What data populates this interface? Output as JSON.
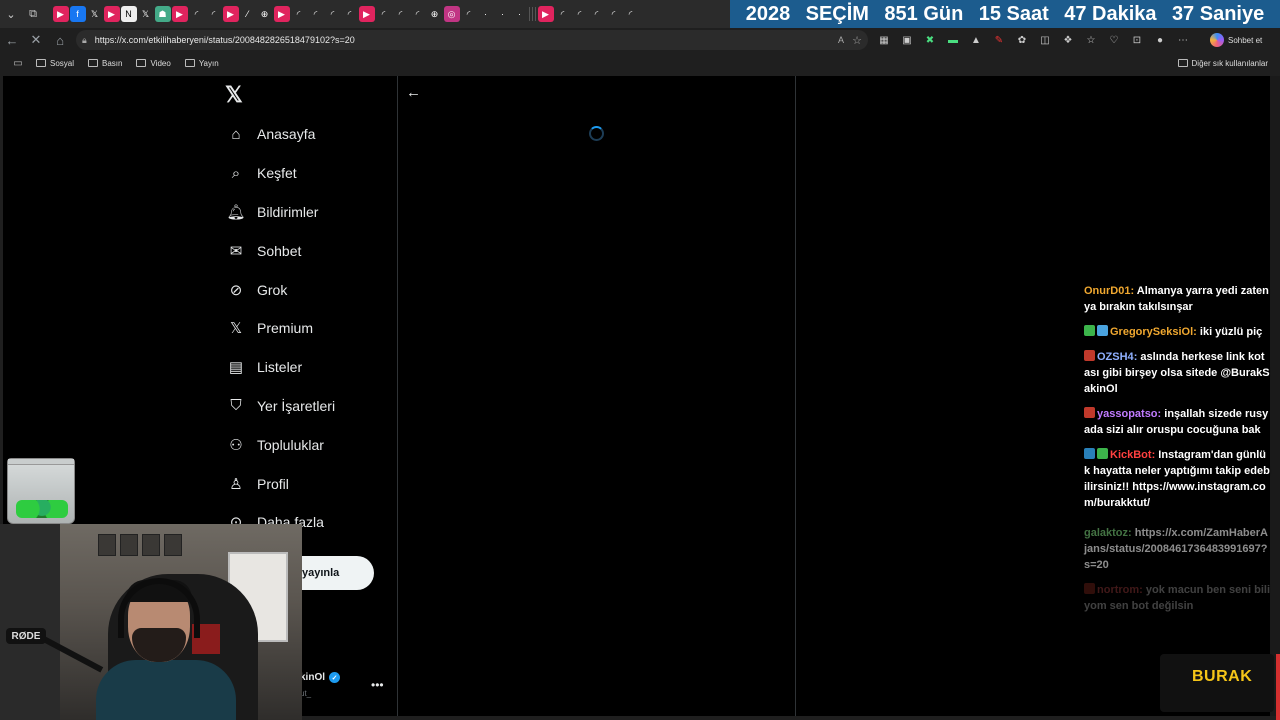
{
  "countdown": {
    "year": "2028",
    "event": "SEÇİM",
    "days": "851 Gün",
    "hours": "15 Saat",
    "minutes": "47 Dakika",
    "seconds": "37 Saniye"
  },
  "address_bar": {
    "url": "https://x.com/etkilihaberyeni/status/2008482826518479102?s=20",
    "copilot_label": "Sohbet et"
  },
  "bookmarks": {
    "items": [
      "Sosyal",
      "Basın",
      "Video",
      "Yayın"
    ],
    "other": "Diğer sık kullanılanlar"
  },
  "x_nav": {
    "items": [
      "Anasayfa",
      "Keşfet",
      "Bildirimler",
      "Sohbet",
      "Grok",
      "Premium",
      "Listeler",
      "Yer İşaretleri",
      "Topluluklar",
      "Profil",
      "Daha fazla"
    ],
    "post_button": "yayınla",
    "profile_name": "kinOl",
    "profile_handle": "ut_"
  },
  "webcam": {
    "mic_brand": "RØDE"
  },
  "chat": {
    "messages": [
      {
        "user": "OnurD01",
        "color": "#f0a830",
        "text": "Almanya yarra yedi zaten ya bırakın takılsınşar"
      },
      {
        "user": "GregorySeksiOl",
        "color": "#f0a830",
        "text": "iki yüzlü piç"
      },
      {
        "user": "OZSH4",
        "color": "#8fb0ff",
        "text": "aslında herkese link kotası gibi birşey olsa sitede @BurakSakinOl"
      },
      {
        "user": "yassopatso",
        "color": "#c07bff",
        "text": "inşallah sizede rusyada sizi alır oruspu cocuğuna bak"
      },
      {
        "user": "KickBot",
        "color": "#ff4040",
        "text": "Instagram'dan günlük hayatta neler yaptığımı takip edebilirsiniz!! https://www.instagram.com/burakktut/"
      },
      {
        "user": "galaktoz",
        "color": "#7ad07a",
        "text": "https://x.com/ZamHaberAjans/status/2008461736483991697?s=20"
      },
      {
        "user": "nortrom",
        "color": "#ff6060",
        "text": "yok macun ben seni biliyom sen bot değilsin"
      }
    ]
  },
  "streamer_badge": "BURAK",
  "colors": {
    "page_bg": "#000000",
    "countdown_bg": "#1c5c8e",
    "accent_blue": "#1d9bf0",
    "badge_yellow": "#f5c518"
  }
}
